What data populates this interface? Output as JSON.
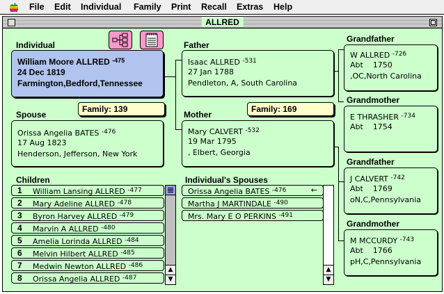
{
  "menubar": {
    "items": [
      "File",
      "Edit",
      "Individual",
      "Family",
      "Print",
      "Recall",
      "Extras",
      "Help"
    ]
  },
  "window": {
    "title": "ALLRED"
  },
  "individual": {
    "label": "Individual",
    "name": "William Moore ALLRED",
    "id": "475",
    "date": "24 Dec 1819",
    "place": "Farmington,Bedford,Tennessee"
  },
  "spouse": {
    "label": "Spouse",
    "name": "Orissa Angelia BATES",
    "id": "476",
    "date": "17 Aug 1823",
    "place": "Henderson, Jefferson, New York",
    "family_label": "Family:",
    "family_num": "139"
  },
  "father": {
    "label": "Father",
    "name": "Isaac ALLRED",
    "id": "531",
    "date": "27 Jan 1788",
    "place": "Pendleton, A, South Carolina"
  },
  "mother": {
    "label": "Mother",
    "name": "Mary CALVERT",
    "id": "532",
    "date": "19 Mar 1795",
    "place": ", Elbert, Georgia",
    "family_label": "Family:",
    "family_num": "169"
  },
  "grandparents": [
    {
      "label": "Grandfather",
      "name": "W ALLRED",
      "id": "726",
      "date": "Abt    1750",
      "place": ",OC,North Carolina"
    },
    {
      "label": "Grandmother",
      "name": "E THRASHER",
      "id": "734",
      "date": "Abt    1754",
      "place": ""
    },
    {
      "label": "Grandfather",
      "name": "J CALVERT",
      "id": "742",
      "date": "Abt    1769",
      "place": "oN,C,Pennsylvania"
    },
    {
      "label": "Grandmother",
      "name": "M MCCURDY",
      "id": "743",
      "date": "Abt    1766",
      "place": "pH,C,Pennsylvania"
    }
  ],
  "children": {
    "label": "Children",
    "items": [
      {
        "n": "1",
        "name": "William Lansing ALLRED",
        "id": "477"
      },
      {
        "n": "2",
        "name": "Mary Adeline ALLRED",
        "id": "478"
      },
      {
        "n": "3",
        "name": "Byron Harvey ALLRED",
        "id": "479"
      },
      {
        "n": "4",
        "name": "Marvin A ALLRED",
        "id": "480"
      },
      {
        "n": "5",
        "name": "Amelia Lorinda ALLRED",
        "id": "484"
      },
      {
        "n": "6",
        "name": "Melvin Hilbert ALLRED",
        "id": "485"
      },
      {
        "n": "7",
        "name": "Medwin Newton ALLRED",
        "id": "486"
      },
      {
        "n": "8",
        "name": "Orissa Angelia ALLRED",
        "id": "487"
      }
    ]
  },
  "spouses": {
    "label": "Individual's Spouses",
    "items": [
      {
        "name": "Orissa Angelia BATES",
        "id": "476",
        "marker": "←"
      },
      {
        "name": "Martha J MARTINDALE",
        "id": "490",
        "marker": ""
      },
      {
        "name": "Mrs. Mary E O PERKINS",
        "id": "491",
        "marker": ""
      }
    ]
  },
  "icons": {
    "pedigree": "pedigree-chart-icon",
    "notes": "notepad-icon",
    "apple": "apple-logo-icon"
  },
  "colors": {
    "window_bg": "#ccffcc",
    "individual_bg": "#b0c4ee",
    "family_tab_bg": "#ffffcc",
    "button_bg": "#ff99cc",
    "scroll_thumb": "#9999ff"
  }
}
